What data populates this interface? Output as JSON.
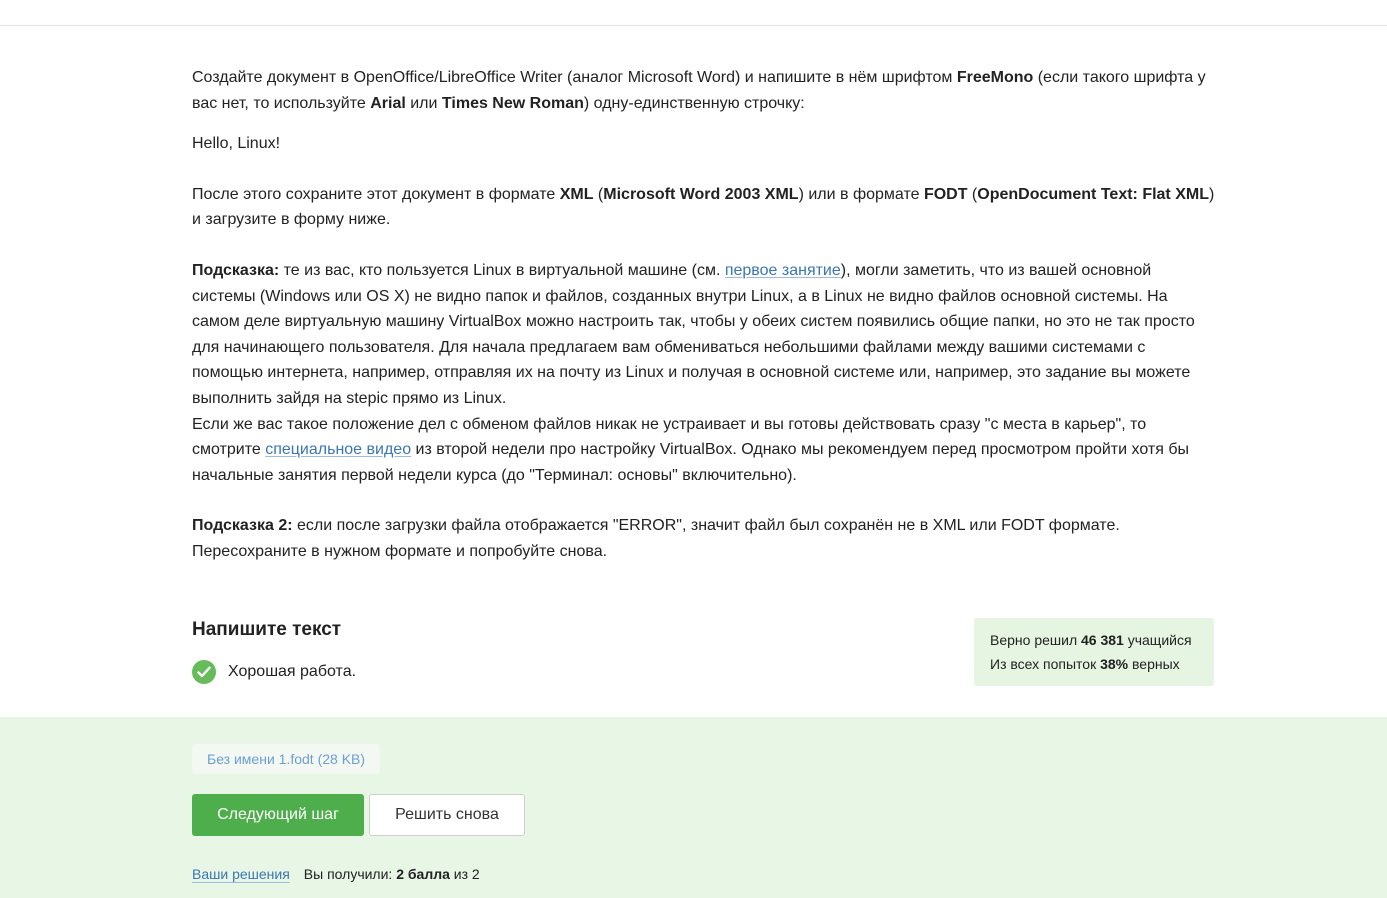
{
  "instructions": {
    "p1_a": "Создайте документ в OpenOffice/LibreOffice Writer (аналог Microsoft Word) и напишите в нём шрифтом ",
    "p1_font1": "FreeMono",
    "p1_b": " (если такого шрифта у вас нет, то используйте ",
    "p1_font2": "Arial",
    "p1_c": " или ",
    "p1_font3": "Times New Roman",
    "p1_d": ") одну-единственную строчку:",
    "sample_text": "Hello, Linux!",
    "p2_a": "После этого сохраните этот документ в формате ",
    "p2_fmt1": "XML",
    "p2_b": " (",
    "p2_fmt1_full": "Microsoft Word 2003 XML",
    "p2_c": ") или в формате ",
    "p2_fmt2": "FODT",
    "p2_d": " (",
    "p2_fmt2_full": "OpenDocument Text: Flat XML",
    "p2_e": ") и загрузите в форму ниже.",
    "hint1_label": "Подсказка:",
    "hint1_a": " те из вас, кто пользуется Linux в виртуальной машине (см. ",
    "hint1_link": "первое занятие",
    "hint1_b": "), могли заметить, что из вашей основной системы (Windows или OS X) не видно папок и файлов, созданных внутри Linux, а в Linux не видно файлов основной системы. На самом деле виртуальную машину VirtualBox можно настроить так, чтобы у обеих систем появились общие папки, но это не так просто для начинающего пользователя. Для начала предлагаем вам обмениваться небольшими файлами между вашими системами с помощью интернета, например, отправляя их на почту из Linux и получая в основной системе или, например, это задание вы можете выполнить зайдя на stepic прямо из Linux.",
    "hint1_c": "Если же вас такое положение дел с обменом файлов никак не устраивает и вы готовы действовать сразу \"с места в карьер\", то смотрите ",
    "hint1_link2": "специальное видео",
    "hint1_d": " из второй недели про настройку VirtualBox. Однако мы рекомендуем перед просмотром пройти хотя бы начальные занятия первой недели курса (до \"Терминал: основы\" включительно).",
    "hint2_label": "Подсказка 2:",
    "hint2_text": " если после загрузки файла отображается \"ERROR\", значит файл был сохранён не в XML или FODT формате. Пересохраните в нужном формате и попробуйте снова."
  },
  "task": {
    "title": "Напишите текст",
    "result_text": "Хорошая работа."
  },
  "stats": {
    "solved_prefix": "Верно решил ",
    "solved_count": "46 381",
    "solved_suffix": " учащийся",
    "attempts_prefix": "Из всех попыток ",
    "attempts_percent": "38%",
    "attempts_suffix": " верных"
  },
  "submission": {
    "file_label": "Без имени 1.fodt (28 KB)",
    "next_button": "Следующий шаг",
    "retry_button": "Решить снова",
    "solutions_link": "Ваши решения",
    "score_prefix": "Вы получили: ",
    "score_value": "2 балла",
    "score_suffix": " из 2"
  },
  "colors": {
    "accent_green": "#4fae4c",
    "check_green": "#66bb5a",
    "link_blue": "#3a76b5",
    "panel_green": "#e8f6e6"
  }
}
